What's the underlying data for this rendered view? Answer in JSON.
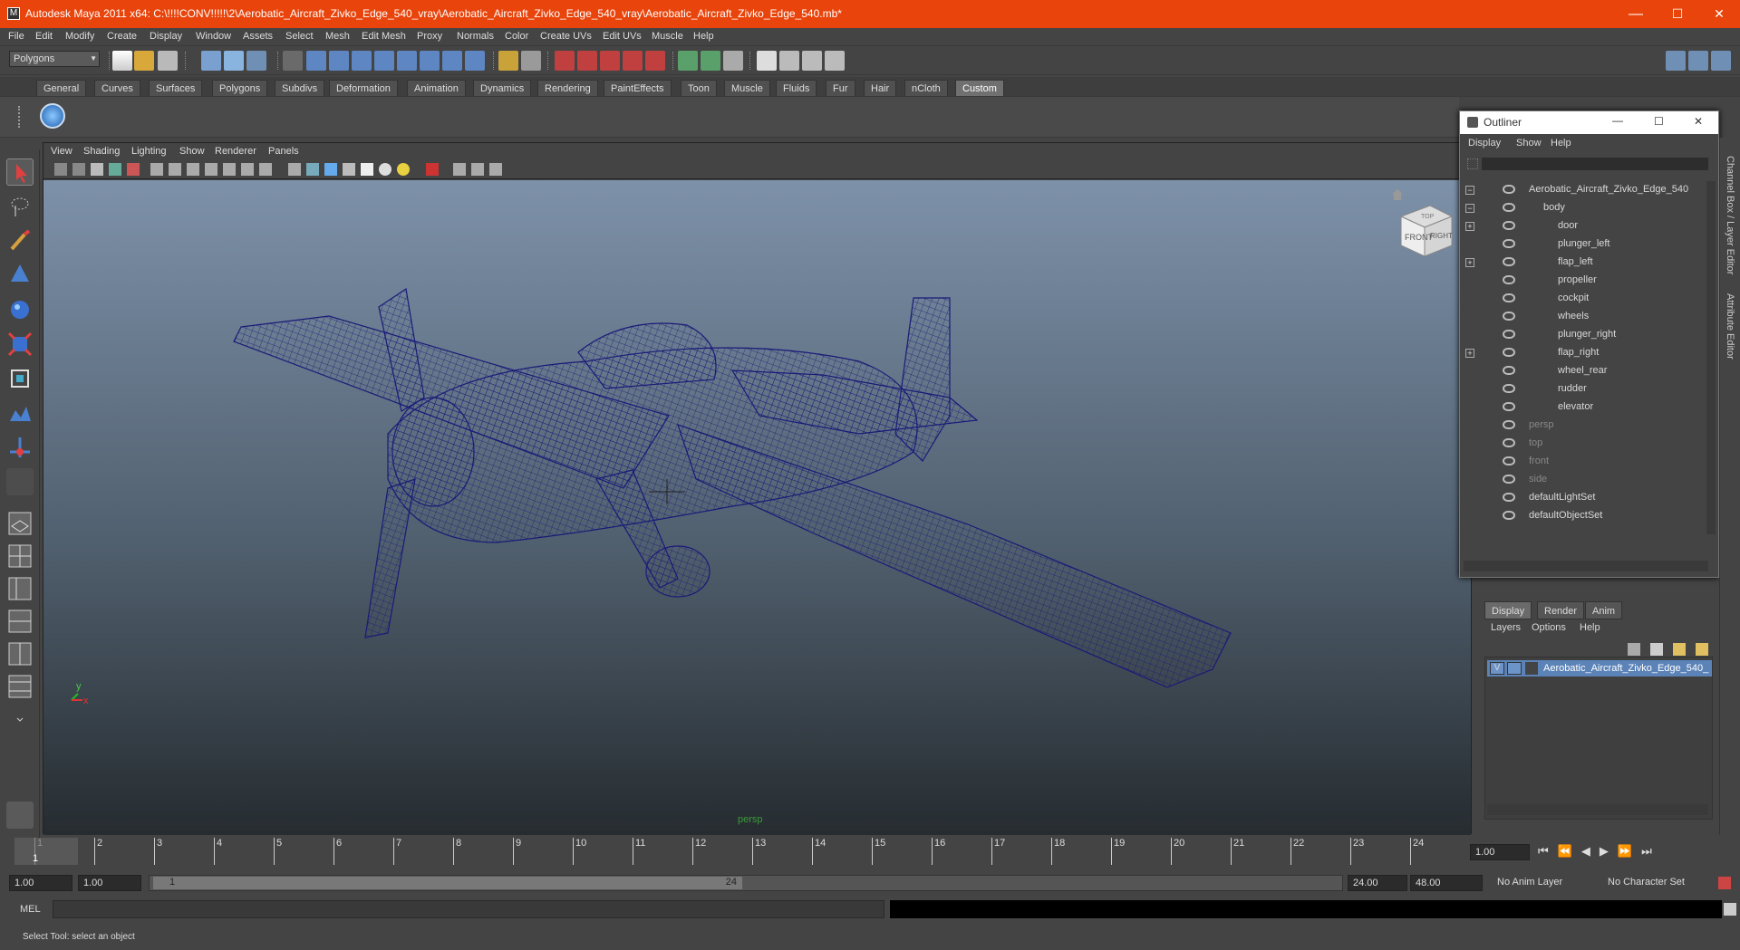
{
  "window": {
    "title": "Autodesk Maya 2011 x64: C:\\!!!!CONV!!!!!\\2\\Aerobatic_Aircraft_Zivko_Edge_540_vray\\Aerobatic_Aircraft_Zivko_Edge_540_vray\\Aerobatic_Aircraft_Zivko_Edge_540.mb*",
    "app_icon": "M",
    "min": "—",
    "max": "☐",
    "close": "✕"
  },
  "menubar": [
    "File",
    "Edit",
    "Modify",
    "Create",
    "Display",
    "Window",
    "Assets",
    "Select",
    "Mesh",
    "Edit Mesh",
    "Proxy",
    "Normals",
    "Color",
    "Create UVs",
    "Edit UVs",
    "Muscle",
    "Help"
  ],
  "status": {
    "mode": "Polygons"
  },
  "shelf_tabs": [
    "General",
    "Curves",
    "Surfaces",
    "Polygons",
    "Subdivs",
    "Deformation",
    "Animation",
    "Dynamics",
    "Rendering",
    "PaintEffects",
    "Toon",
    "Muscle",
    "Fluids",
    "Fur",
    "Hair",
    "nCloth",
    "Custom"
  ],
  "active_shelf": "Custom",
  "viewport": {
    "menus": [
      "View",
      "Shading",
      "Lighting",
      "Show",
      "Renderer",
      "Panels"
    ],
    "camera_label": "persp",
    "cube_front": "FRONT",
    "cube_right": "RIGHT",
    "cube_top": "TOP",
    "axis_x": "x",
    "axis_y": "y",
    "accent": "#1a1a78"
  },
  "outliner": {
    "title": "Outliner",
    "menus": [
      "Display",
      "Show",
      "Help"
    ],
    "items": [
      {
        "label": "Aerobatic_Aircraft_Zivko_Edge_540",
        "indent": 0,
        "dim": false,
        "expander": "−"
      },
      {
        "label": "body",
        "indent": 1,
        "dim": false,
        "expander": "−"
      },
      {
        "label": "door",
        "indent": 2,
        "dim": false,
        "expander": "+"
      },
      {
        "label": "plunger_left",
        "indent": 2,
        "dim": false,
        "expander": ""
      },
      {
        "label": "flap_left",
        "indent": 2,
        "dim": false,
        "expander": "+"
      },
      {
        "label": "propeller",
        "indent": 2,
        "dim": false,
        "expander": ""
      },
      {
        "label": "cockpit",
        "indent": 2,
        "dim": false,
        "expander": ""
      },
      {
        "label": "wheels",
        "indent": 2,
        "dim": false,
        "expander": ""
      },
      {
        "label": "plunger_right",
        "indent": 2,
        "dim": false,
        "expander": ""
      },
      {
        "label": "flap_right",
        "indent": 2,
        "dim": false,
        "expander": "+"
      },
      {
        "label": "wheel_rear",
        "indent": 2,
        "dim": false,
        "expander": ""
      },
      {
        "label": "rudder",
        "indent": 2,
        "dim": false,
        "expander": ""
      },
      {
        "label": "elevator",
        "indent": 2,
        "dim": false,
        "expander": ""
      },
      {
        "label": "persp",
        "indent": 0,
        "dim": true,
        "expander": ""
      },
      {
        "label": "top",
        "indent": 0,
        "dim": true,
        "expander": ""
      },
      {
        "label": "front",
        "indent": 0,
        "dim": true,
        "expander": ""
      },
      {
        "label": "side",
        "indent": 0,
        "dim": true,
        "expander": ""
      },
      {
        "label": "defaultLightSet",
        "indent": 0,
        "dim": false,
        "expander": ""
      },
      {
        "label": "defaultObjectSet",
        "indent": 0,
        "dim": false,
        "expander": ""
      }
    ]
  },
  "side_tabs": {
    "channel_box": "Channel Box / Layer Editor",
    "attribute_editor": "Attribute Editor"
  },
  "layers": {
    "tabs": [
      "Display",
      "Render",
      "Anim"
    ],
    "menus": [
      "Layers",
      "Options",
      "Help"
    ],
    "layer_name": "Aerobatic_Aircraft_Zivko_Edge_540_",
    "visible": "V"
  },
  "timeline": {
    "ticks": [
      "1",
      "2",
      "3",
      "4",
      "5",
      "6",
      "7",
      "8",
      "9",
      "10",
      "11",
      "12",
      "13",
      "14",
      "15",
      "16",
      "17",
      "18",
      "19",
      "20",
      "21",
      "22",
      "23",
      "24"
    ],
    "current_frame": "1",
    "current_time": "1.00"
  },
  "range": {
    "start": "1.00",
    "playback_start": "1.00",
    "slider_start": "1",
    "slider_end": "24",
    "playback_end": "24.00",
    "end": "48.00",
    "anim_layer": "No Anim Layer",
    "character_set": "No Character Set"
  },
  "command": {
    "label": "MEL",
    "value": ""
  },
  "helpline": "Select Tool: select an object"
}
